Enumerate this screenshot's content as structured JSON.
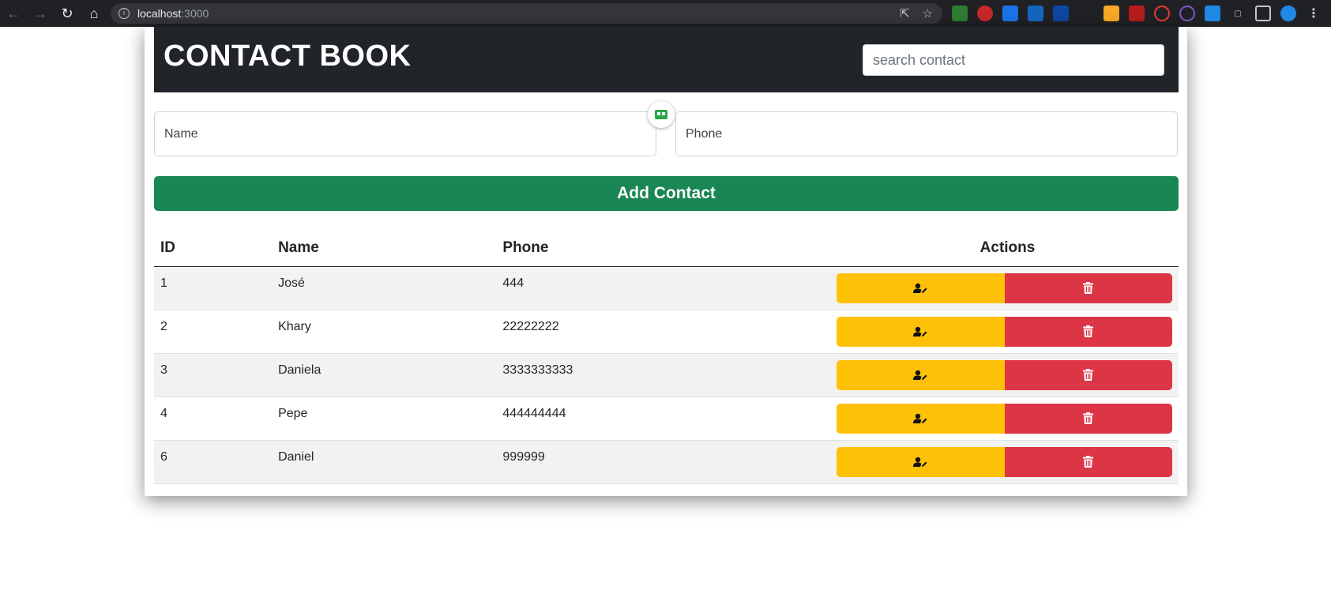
{
  "browser": {
    "url_host": "localhost",
    "url_port": ":3000"
  },
  "app": {
    "title": "CONTACT BOOK",
    "search_placeholder": "search contact"
  },
  "form": {
    "name_placeholder": "Name",
    "phone_placeholder": "Phone",
    "add_button_label": "Add Contact"
  },
  "table": {
    "headers": {
      "id": "ID",
      "name": "Name",
      "phone": "Phone",
      "actions": "Actions"
    },
    "rows": [
      {
        "id": "1",
        "name": "José",
        "phone": "444"
      },
      {
        "id": "2",
        "name": "Khary",
        "phone": "22222222"
      },
      {
        "id": "3",
        "name": "Daniela",
        "phone": "3333333333"
      },
      {
        "id": "4",
        "name": "Pepe",
        "phone": "444444444"
      },
      {
        "id": "6",
        "name": "Daniel",
        "phone": "999999"
      }
    ],
    "edit_icon": "user-pen-icon",
    "delete_icon": "trash-icon"
  },
  "colors": {
    "navbar": "#212529",
    "add_button": "#198754",
    "edit_button": "#ffc107",
    "delete_button": "#dc3545"
  }
}
